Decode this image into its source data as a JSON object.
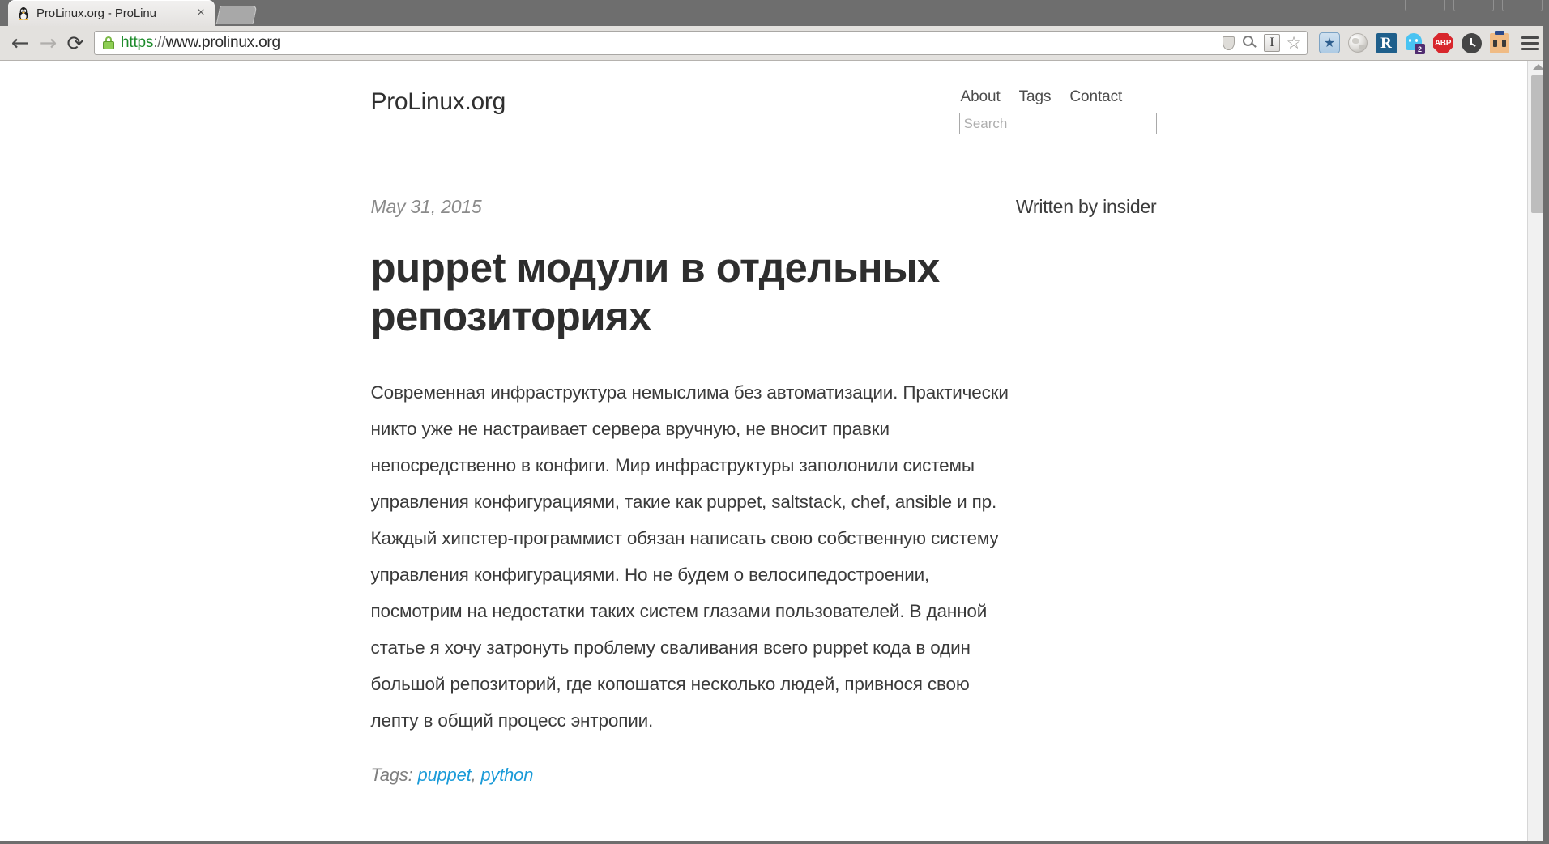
{
  "browser": {
    "tab": {
      "title": "ProLinux.org - ProLinu",
      "favicon": "tux-penguin-icon",
      "close_label": "×"
    },
    "newtab_label": "",
    "nav": {
      "back": "←",
      "forward": "→",
      "reload": "⟳"
    },
    "url": {
      "scheme": "https",
      "separator": "://",
      "host": "www.prolinux.org",
      "full": "https://www.prolinux.org",
      "secure": true
    },
    "url_icons": [
      {
        "name": "shield-icon",
        "label": ""
      },
      {
        "name": "zoom-out-icon",
        "label": ""
      },
      {
        "name": "reader-mode-icon",
        "label": "I"
      },
      {
        "name": "bookmark-star-icon",
        "label": "☆"
      }
    ],
    "extensions": [
      {
        "name": "bookmarks-star-icon",
        "label": "★"
      },
      {
        "name": "globe-icon",
        "label": ""
      },
      {
        "name": "readability-icon",
        "label": "R"
      },
      {
        "name": "ghostery-icon",
        "label": "",
        "badge": "2"
      },
      {
        "name": "adblock-plus-icon",
        "label": "ABP"
      },
      {
        "name": "clock-icon",
        "label": ""
      },
      {
        "name": "power-outlet-icon",
        "label": ""
      }
    ],
    "menu_label": ""
  },
  "site": {
    "title": "ProLinux.org",
    "nav": [
      {
        "label": "About"
      },
      {
        "label": "Tags"
      },
      {
        "label": "Contact"
      }
    ],
    "search": {
      "placeholder": "Search",
      "value": ""
    }
  },
  "post": {
    "date": "May 31, 2015",
    "author": "Written by insider",
    "title": "puppet модули в отдельных репозиториях",
    "body": "Современная инфраструктура немыслима без автоматизации. Практически никто уже не настраивает сервера вручную, не вносит правки непосредственно в конфиги. Мир инфраструктуры заполонили системы управления конфигурациями, такие как puppet, saltstack, chef, ansible и пр. Каждый хипстер-программист обязан написать свою собственную систему управления конфигурациями. Но не будем о велосипедостроении, посмотрим на недостатки таких систем глазами пользователей. В данной статье я хочу затронуть проблему сваливания всего puppet кода в один большой репозиторий, где копошатся несколько людей, привнося свою лепту в общий процесс энтропии.",
    "tags_label": "Tags:",
    "tags": [
      {
        "label": "puppet"
      },
      {
        "label": "python"
      }
    ],
    "tags_separator": ","
  },
  "colors": {
    "link": "#1b9bd8",
    "text": "#3a3a3a",
    "chrome": "#e3e1de",
    "tabstrip": "#6e6e6e",
    "secure": "#1d8b2b"
  }
}
